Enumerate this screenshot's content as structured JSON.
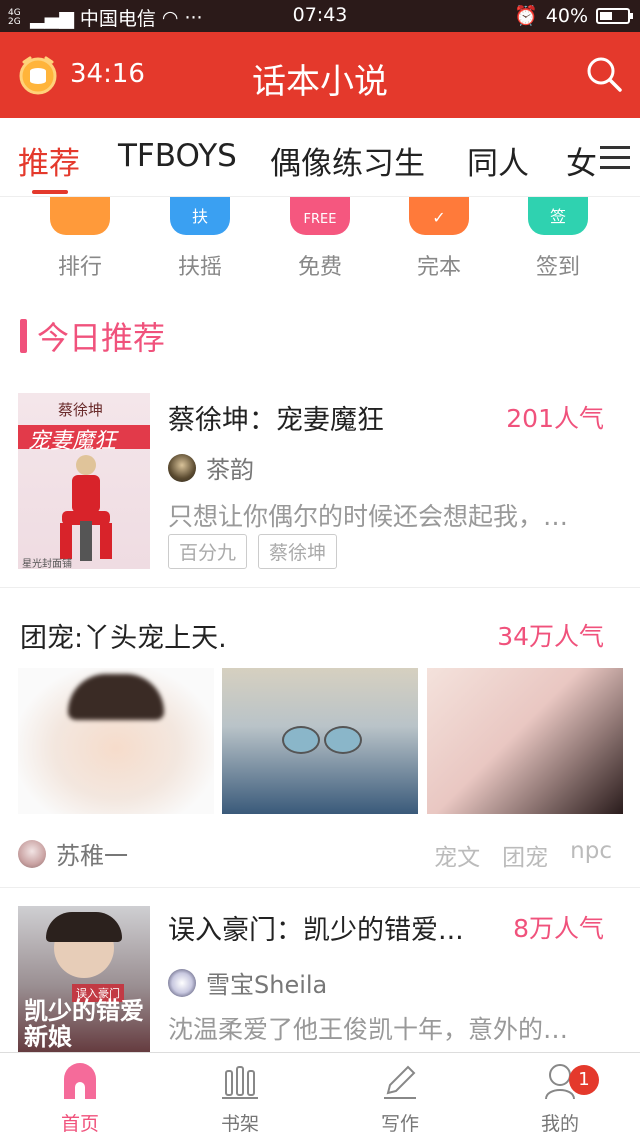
{
  "status": {
    "network": "4G 2G",
    "carrier": "中国电信",
    "more": "···",
    "time": "07:43",
    "battery": "40%"
  },
  "header": {
    "timer": "34:16",
    "title": "话本小说"
  },
  "tabs": [
    "推荐",
    "TFBOYS",
    "偶像练习生",
    "同人",
    "女"
  ],
  "quick_links": [
    {
      "label": "排行",
      "glyph": "",
      "color": "#ff9a3a"
    },
    {
      "label": "扶摇",
      "glyph": "扶",
      "color": "#3aa0f2"
    },
    {
      "label": "免费",
      "glyph": "FREE",
      "color": "#f5577f"
    },
    {
      "label": "完本",
      "glyph": "✓",
      "color": "#ff7a3a"
    },
    {
      "label": "签到",
      "glyph": "签",
      "color": "#2fd2b0"
    }
  ],
  "section_title": "今日推荐",
  "book1": {
    "title": "蔡徐坤：宠妻魔狂",
    "popularity": "201人气",
    "author": "茶韵",
    "desc": "只想让你偶尔的时候还会想起我，…",
    "tags": [
      "百分九",
      "蔡徐坤"
    ],
    "cover": {
      "top_text": "蔡徐坤",
      "sub_text": "宠妻魔狂",
      "corner_text": "星光封面铺"
    }
  },
  "book2": {
    "title": "团宠:丫头宠上天.",
    "popularity": "34万人气",
    "author": "苏稚一",
    "tags": [
      "宠文",
      "团宠",
      "npc"
    ]
  },
  "book3": {
    "title": "误入豪门：凯少的错爱...",
    "popularity": "8万人气",
    "author": "雪宝Sheila",
    "desc": "沈温柔爱了他王俊凯十年，意外的…",
    "cover": {
      "top_text": "误入豪门",
      "sub_text": "凯少的错爱新娘"
    }
  },
  "bottom_nav": [
    {
      "label": "首页"
    },
    {
      "label": "书架"
    },
    {
      "label": "写作"
    },
    {
      "label": "我的",
      "badge": "1"
    }
  ]
}
